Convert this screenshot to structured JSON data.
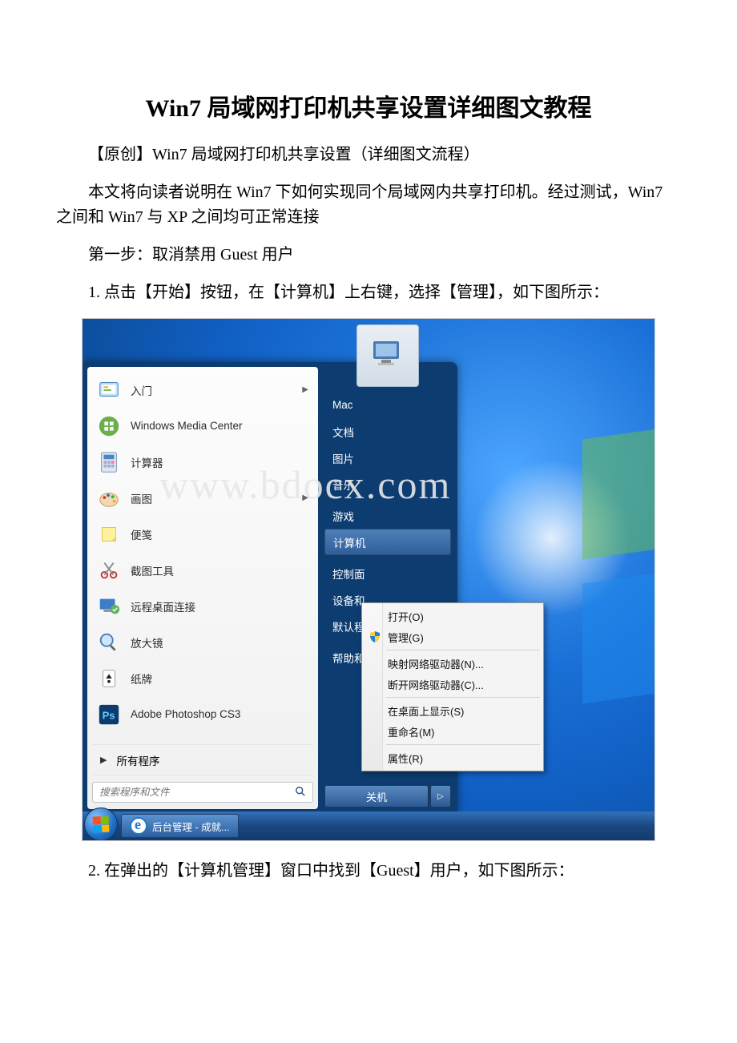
{
  "title": "Win7 局域网打印机共享设置详细图文教程",
  "p1": "【原创】Win7 局域网打印机共享设置（详细图文流程）",
  "p2": "本文将向读者说明在 Win7 下如何实现同个局域网内共享打印机。经过测试，Win7 之间和 Win7 与 XP 之间均可正常连接",
  "p3": "第一步：取消禁用 Guest 用户",
  "p4": "1. 点击【开始】按钮，在【计算机】上右键，选择【管理】，如下图所示：",
  "p5": "2. 在弹出的【计算机管理】窗口中找到【Guest】用户，如下图所示：",
  "watermark": "www.bdocx.com",
  "startmenu": {
    "programs": [
      {
        "label": "入门",
        "arrow": true
      },
      {
        "label": "Windows Media Center",
        "arrow": false
      },
      {
        "label": "计算器",
        "arrow": false
      },
      {
        "label": "画图",
        "arrow": true
      },
      {
        "label": "便笺",
        "arrow": false
      },
      {
        "label": "截图工具",
        "arrow": false
      },
      {
        "label": "远程桌面连接",
        "arrow": false
      },
      {
        "label": "放大镜",
        "arrow": false
      },
      {
        "label": "纸牌",
        "arrow": false
      },
      {
        "label": "Adobe Photoshop CS3",
        "arrow": false
      }
    ],
    "all_programs": "所有程序",
    "search_placeholder": "搜索程序和文件",
    "right_items": [
      "Mac",
      "文档",
      "图片",
      "音乐",
      "游戏",
      "计算机",
      "控制面",
      "设备和",
      "默认程",
      "帮助和"
    ],
    "selected_right_index": 5,
    "shutdown": "关机"
  },
  "contextmenu": {
    "items_1": [
      "打开(O)",
      "管理(G)"
    ],
    "items_2": [
      "映射网络驱动器(N)...",
      "断开网络驱动器(C)..."
    ],
    "items_3": [
      "在桌面上显示(S)",
      "重命名(M)"
    ],
    "items_4": [
      "属性(R)"
    ]
  },
  "taskbar": {
    "task1": "后台管理 - 成就..."
  }
}
